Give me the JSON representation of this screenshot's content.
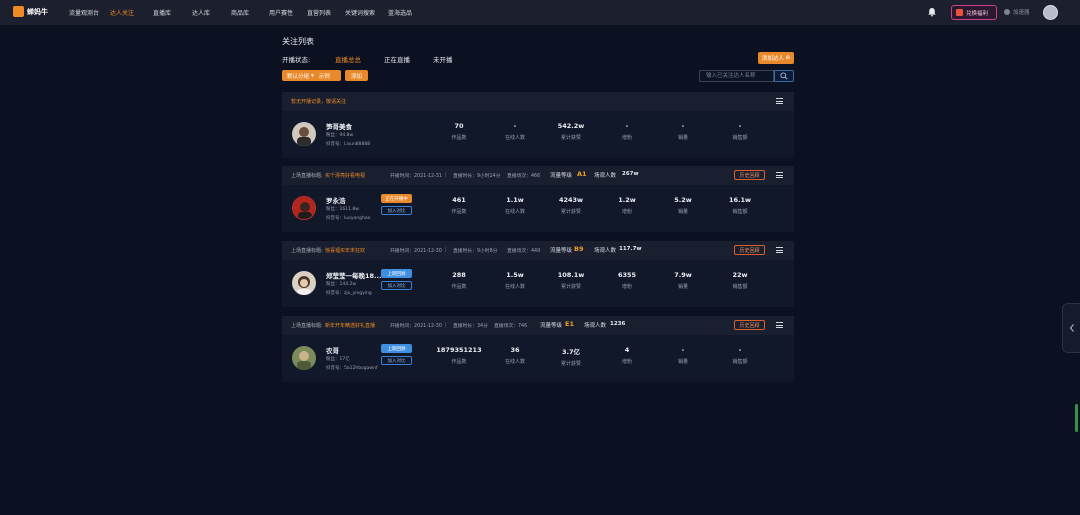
{
  "nav": {
    "logo_text": "蝉妈牛",
    "items": [
      "流量观测台",
      "达人关注",
      "直播库",
      "达人库",
      "商品库",
      "用户赛性",
      "直营列表",
      "关键词搜索",
      "蓝海选品"
    ],
    "active_index": 1,
    "exchange_label": "兑换福利",
    "sponsor_label": "加速器"
  },
  "page": {
    "title": "关注列表",
    "status_label": "开播状态:",
    "status_tabs": [
      "直播总总",
      "正在直播",
      "未开播"
    ],
    "active_status": 0,
    "add_expert_label": "添加达人",
    "group_label": "默认分组",
    "group_count": "示例",
    "add_label": "添加",
    "search_placeholder": "输入已关注达人名称"
  },
  "first_bar": {
    "label": "暂无开播记录，敬请关注"
  },
  "experts": [
    {
      "name": "笋哥美食",
      "fans": "粉丝：94.8w",
      "douyin_id": "抖音号：Lisun88888",
      "stats": [
        {
          "value": "70",
          "label": "作品数"
        },
        {
          "value": "-",
          "label": "在线人数"
        },
        {
          "value": "542.2w",
          "label": "累计获赞"
        },
        {
          "value": "-",
          "label": "增粉"
        },
        {
          "value": "-",
          "label": "销量"
        },
        {
          "value": "-",
          "label": "销售额"
        }
      ]
    },
    {
      "bar": {
        "title_label": "上场直播标题:",
        "title": "买个漂亮好看电视",
        "start_time": "开播时间：2021-12-31",
        "duration": "直播时长：9小时24分",
        "count": "直播场次：466",
        "flow_label": "流量等级",
        "grade": "A1",
        "viewers_label": "场观人数",
        "viewers": "267w",
        "history_label": "历史回顾"
      },
      "name": "罗永浩",
      "fans": "粉丝：1611.8w",
      "douyin_id": "抖音号：luoyonghao",
      "live_tag": "正在开播中",
      "live_tag_color": "#e88a2c",
      "join_label": "加入对比",
      "stats": [
        {
          "value": "461",
          "label": "作品数"
        },
        {
          "value": "1.1w",
          "label": "在线人数"
        },
        {
          "value": "4243w",
          "label": "累计获赞"
        },
        {
          "value": "1.2w",
          "label": "增粉"
        },
        {
          "value": "5.2w",
          "label": "销量"
        },
        {
          "value": "16.1w",
          "label": "销售额"
        }
      ]
    },
    {
      "bar": {
        "title_label": "上场直播标题:",
        "title": "惊喜福买年末狂欢",
        "start_time": "开播时间：2021-12-30",
        "duration": "直播时长：9小时8分",
        "count": "直播场次：449",
        "flow_label": "流量等级",
        "grade": "B9",
        "viewers_label": "场观人数",
        "viewers": "117.7w",
        "history_label": "历史回顾"
      },
      "name": "郑莹莹一每晚18...",
      "fans": "粉丝：144.2w",
      "douyin_id": "抖音号：zjx_yingying",
      "live_tag": "上期回顾",
      "live_tag_color": "#3f8fe0",
      "join_label": "加入对比",
      "stats": [
        {
          "value": "288",
          "label": "作品数"
        },
        {
          "value": "1.5w",
          "label": "在线人数"
        },
        {
          "value": "108.1w",
          "label": "累计获赞"
        },
        {
          "value": "6355",
          "label": "增粉"
        },
        {
          "value": "7.9w",
          "label": "销量"
        },
        {
          "value": "22w",
          "label": "销售额"
        }
      ]
    },
    {
      "bar": {
        "title_label": "上场直播标题:",
        "title": "新年开年精选好礼直播",
        "start_time": "开播时间：2021-12-30",
        "duration": "直播时长：34分",
        "count": "直播场次：746",
        "flow_label": "流量等级",
        "grade": "E1",
        "viewers_label": "场观人数",
        "viewers": "1236",
        "history_label": "历史回顾"
      },
      "name": "农哥",
      "fans": "粉丝：17亿",
      "douyin_id": "抖音号：5a12hbogawnf",
      "live_tag": "上期回顾",
      "live_tag_color": "#3f8fe0",
      "join_label": "加入对比",
      "stats": [
        {
          "value": "1879351213",
          "label": "作品数"
        },
        {
          "value": "36",
          "label": "在线人数"
        },
        {
          "value": "3.7亿",
          "label": "累计获赞"
        },
        {
          "value": "4",
          "label": "增粉"
        },
        {
          "value": "-",
          "label": "销量"
        },
        {
          "value": "-",
          "label": "销售额"
        }
      ]
    }
  ]
}
